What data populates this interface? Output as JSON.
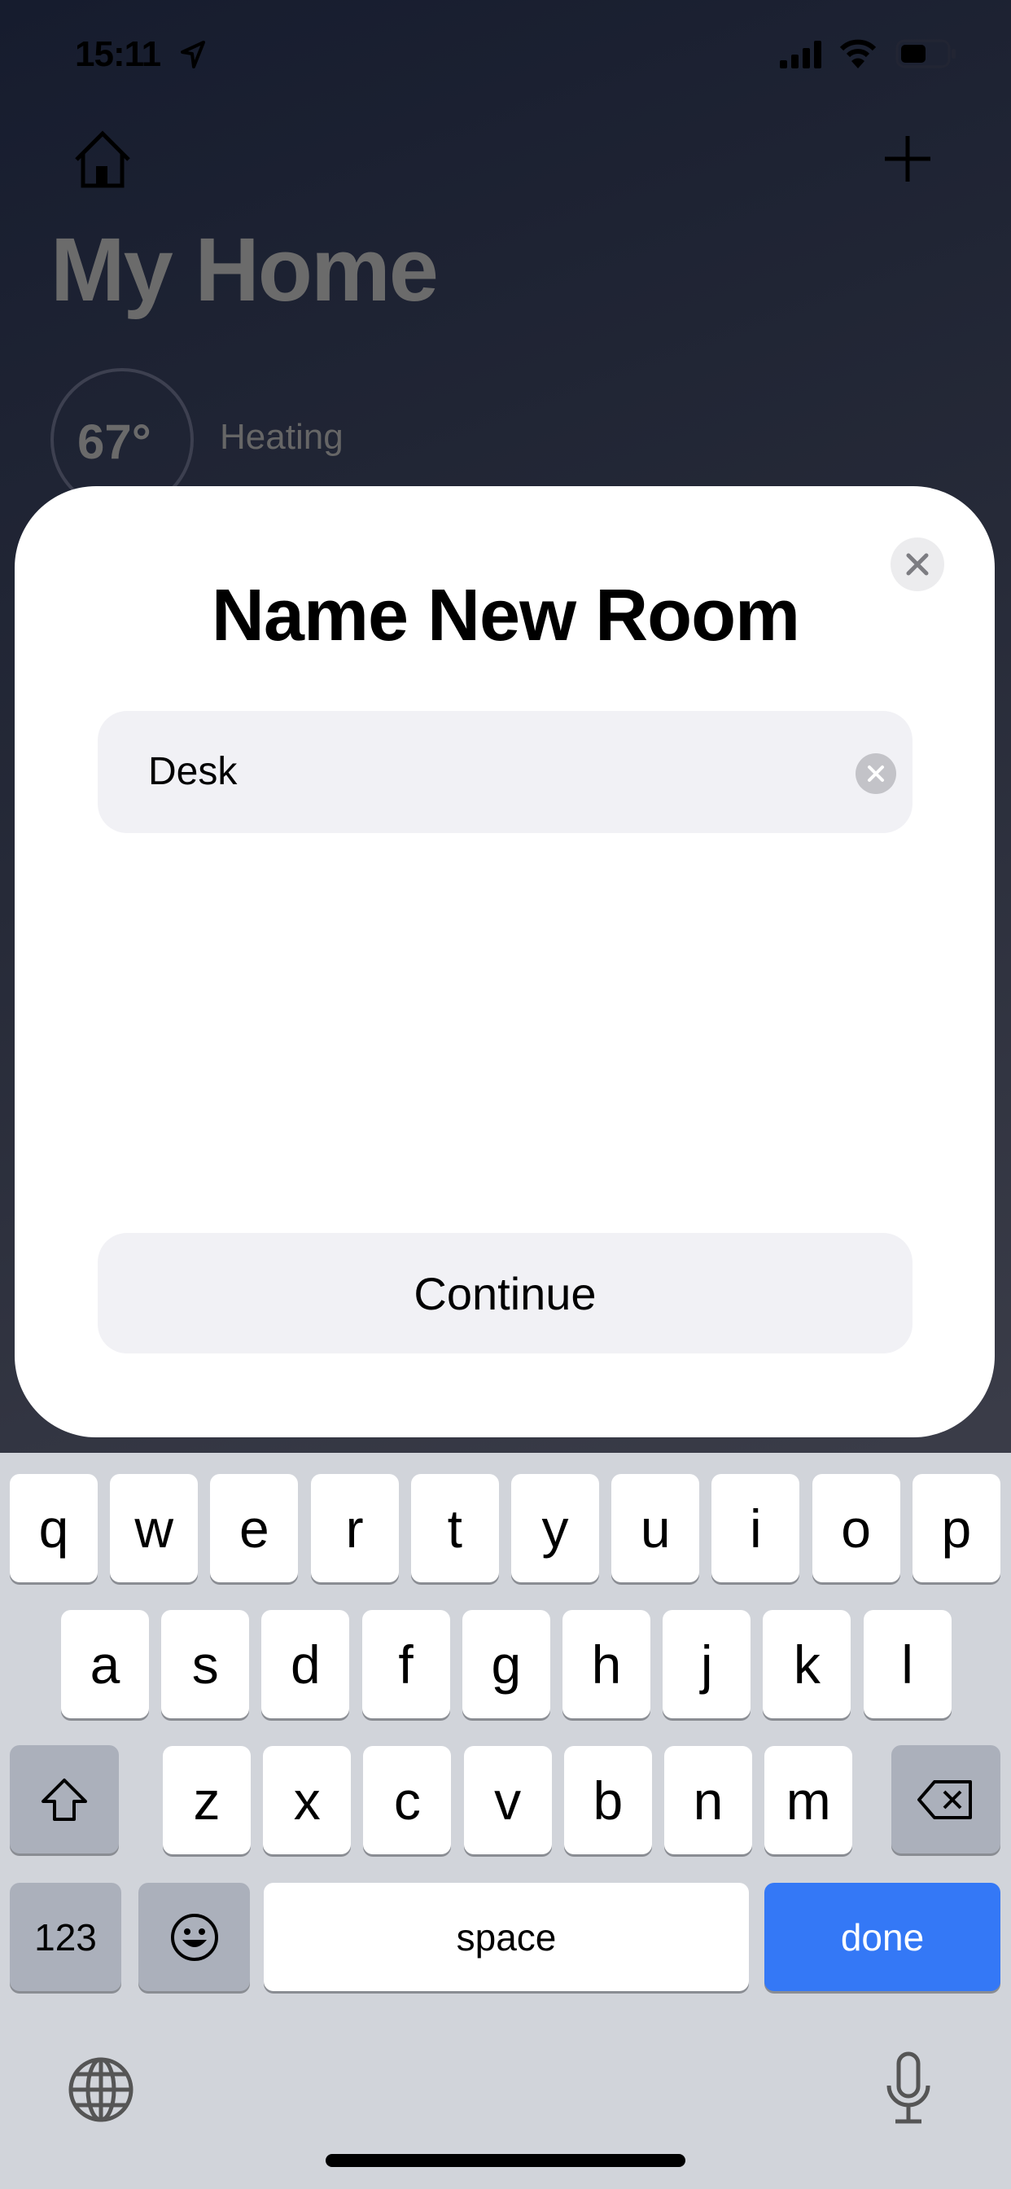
{
  "status_bar": {
    "time": "15:11",
    "icons": [
      "location-arrow-icon",
      "signal-icon",
      "wifi-icon",
      "battery-icon"
    ]
  },
  "background": {
    "title": "My Home",
    "temperature": "67°",
    "mode": "Heating",
    "icons": [
      "home-icon",
      "plus-icon"
    ]
  },
  "modal": {
    "title": "Name New Room",
    "input_value": "Desk",
    "continue_label": "Continue"
  },
  "keyboard": {
    "row1": [
      "q",
      "w",
      "e",
      "r",
      "t",
      "y",
      "u",
      "i",
      "o",
      "p"
    ],
    "row2": [
      "a",
      "s",
      "d",
      "f",
      "g",
      "h",
      "j",
      "k",
      "l"
    ],
    "row3": [
      "z",
      "x",
      "c",
      "v",
      "b",
      "n",
      "m"
    ],
    "numbers_label": "123",
    "space_label": "space",
    "done_label": "done",
    "done_color": "#3478f6"
  }
}
